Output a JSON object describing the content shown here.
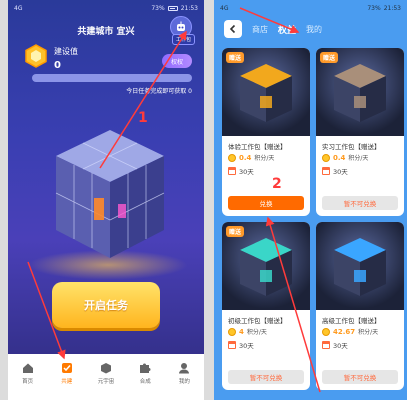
{
  "left": {
    "status": {
      "carrier": "4G",
      "battery": "73%",
      "time": "21:53"
    },
    "title": "共建城市 宜兴",
    "work_badge": "工作包",
    "build_label": "建设值",
    "build_value": "0",
    "transfer_label": "权权",
    "progress_fraction": 0.0,
    "task_note": "今日任务完成即可获取",
    "task_note_value": "0",
    "start_button": "开启任务",
    "nav": [
      {
        "label": "首页",
        "icon": "home-icon"
      },
      {
        "label": "共建",
        "icon": "checkbox-icon"
      },
      {
        "label": "元宇宙",
        "icon": "cube-icon"
      },
      {
        "label": "合成",
        "icon": "puzzle-icon"
      },
      {
        "label": "我的",
        "icon": "user-icon"
      }
    ],
    "active_nav": 1
  },
  "right": {
    "status": {
      "carrier": "4G",
      "battery": "73%",
      "time": "21:53"
    },
    "tabs": [
      "商店",
      "权益",
      "我的"
    ],
    "active_tab": 1,
    "cards": [
      {
        "tag": "赠送",
        "name": "体验工作包【赠送】",
        "rate": "0.4",
        "rate_unit": "积分/天",
        "days": "30天",
        "button": "兑换",
        "enabled": true,
        "color": "#f2a81d"
      },
      {
        "tag": "赠送",
        "name": "实习工作包【赠送】",
        "rate": "0.4",
        "rate_unit": "积分/天",
        "days": "30天",
        "button": "暂不可兑换",
        "enabled": false,
        "color": "#a98f7a"
      },
      {
        "tag": "赠送",
        "name": "初级工作包【赠送】",
        "rate": "4",
        "rate_unit": "积分/天",
        "days": "30天",
        "button": "暂不可兑换",
        "enabled": false,
        "color": "#3ad6c8"
      },
      {
        "tag": "",
        "name": "高级工作包【赠送】",
        "rate": "42.67",
        "rate_unit": "积分/天",
        "days": "30天",
        "button": "暂不可兑换",
        "enabled": false,
        "color": "#3aa6ff"
      }
    ]
  },
  "annotations": {
    "step1": "1",
    "step2": "2",
    "color": "#ff3b3b"
  }
}
